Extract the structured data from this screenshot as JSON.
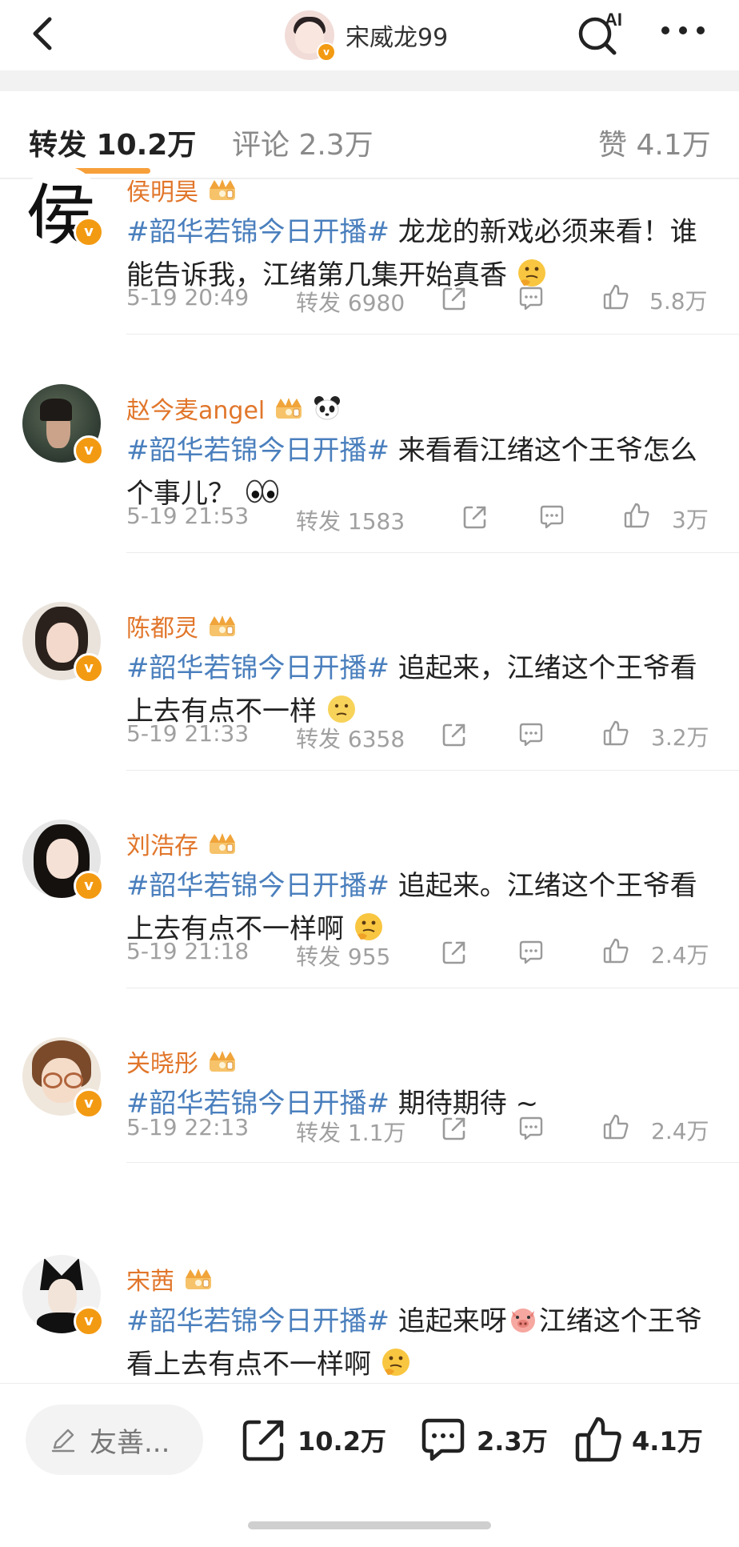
{
  "header": {
    "username": "宋威龙99",
    "ai_label": "AI"
  },
  "tabs": [
    {
      "label": "转发 10.2万",
      "active": true
    },
    {
      "label": "评论 2.3万",
      "active": false
    },
    {
      "label": "赞 4.1万",
      "active": false
    }
  ],
  "reposts": [
    {
      "name": "侯明昊",
      "avatar_char": "侯",
      "topic": "#韶华若锦今日开播#",
      "text": " 龙龙的新戏必须来看！谁能告诉我，江绪第几集开始真香",
      "emoji": "thinking",
      "time": "5-19 20:49",
      "repost": "转发 6980",
      "likes": "5.8万"
    },
    {
      "name": "赵今麦angel",
      "topic": "#韶华若锦今日开播#",
      "text": " 来看看江绪这个王爷怎么个事儿？",
      "emoji": "eyes",
      "time": "5-19 21:53",
      "repost": "转发 1583",
      "likes": "3万"
    },
    {
      "name": "陈都灵",
      "topic": "#韶华若锦今日开播#",
      "text": " 追起来，江绪这个王爷看上去有点不一样",
      "emoji": "hmm",
      "time": "5-19 21:33",
      "repost": "转发 6358",
      "likes": "3.2万"
    },
    {
      "name": "刘浩存",
      "topic": "#韶华若锦今日开播#",
      "text": " 追起来。江绪这个王爷看上去有点不一样啊",
      "emoji": "thinking",
      "time": "5-19 21:18",
      "repost": "转发 955",
      "likes": "2.4万"
    },
    {
      "name": "关晓彤",
      "topic": "#韶华若锦今日开播#",
      "text": " 期待期待 ~",
      "emoji": "",
      "time": "5-19 22:13",
      "repost": "转发 1.1万",
      "likes": "2.4万"
    },
    {
      "name": "宋茜",
      "topic": "#韶华若锦今日开播#",
      "text": " 追起来呀",
      "text2": "江绪这个王爷看上去有点不一样啊",
      "emoji": "thinking",
      "time": "",
      "repost": "",
      "likes": ""
    }
  ],
  "bottom": {
    "compose_placeholder": "友善...",
    "reposts": "10.2万",
    "comments": "2.3万",
    "likes": "4.1万"
  },
  "colors": {
    "accent": "#f7a03a",
    "username": "#e1762b",
    "topic": "#4a7fbd",
    "meta": "#a0a0a0"
  }
}
